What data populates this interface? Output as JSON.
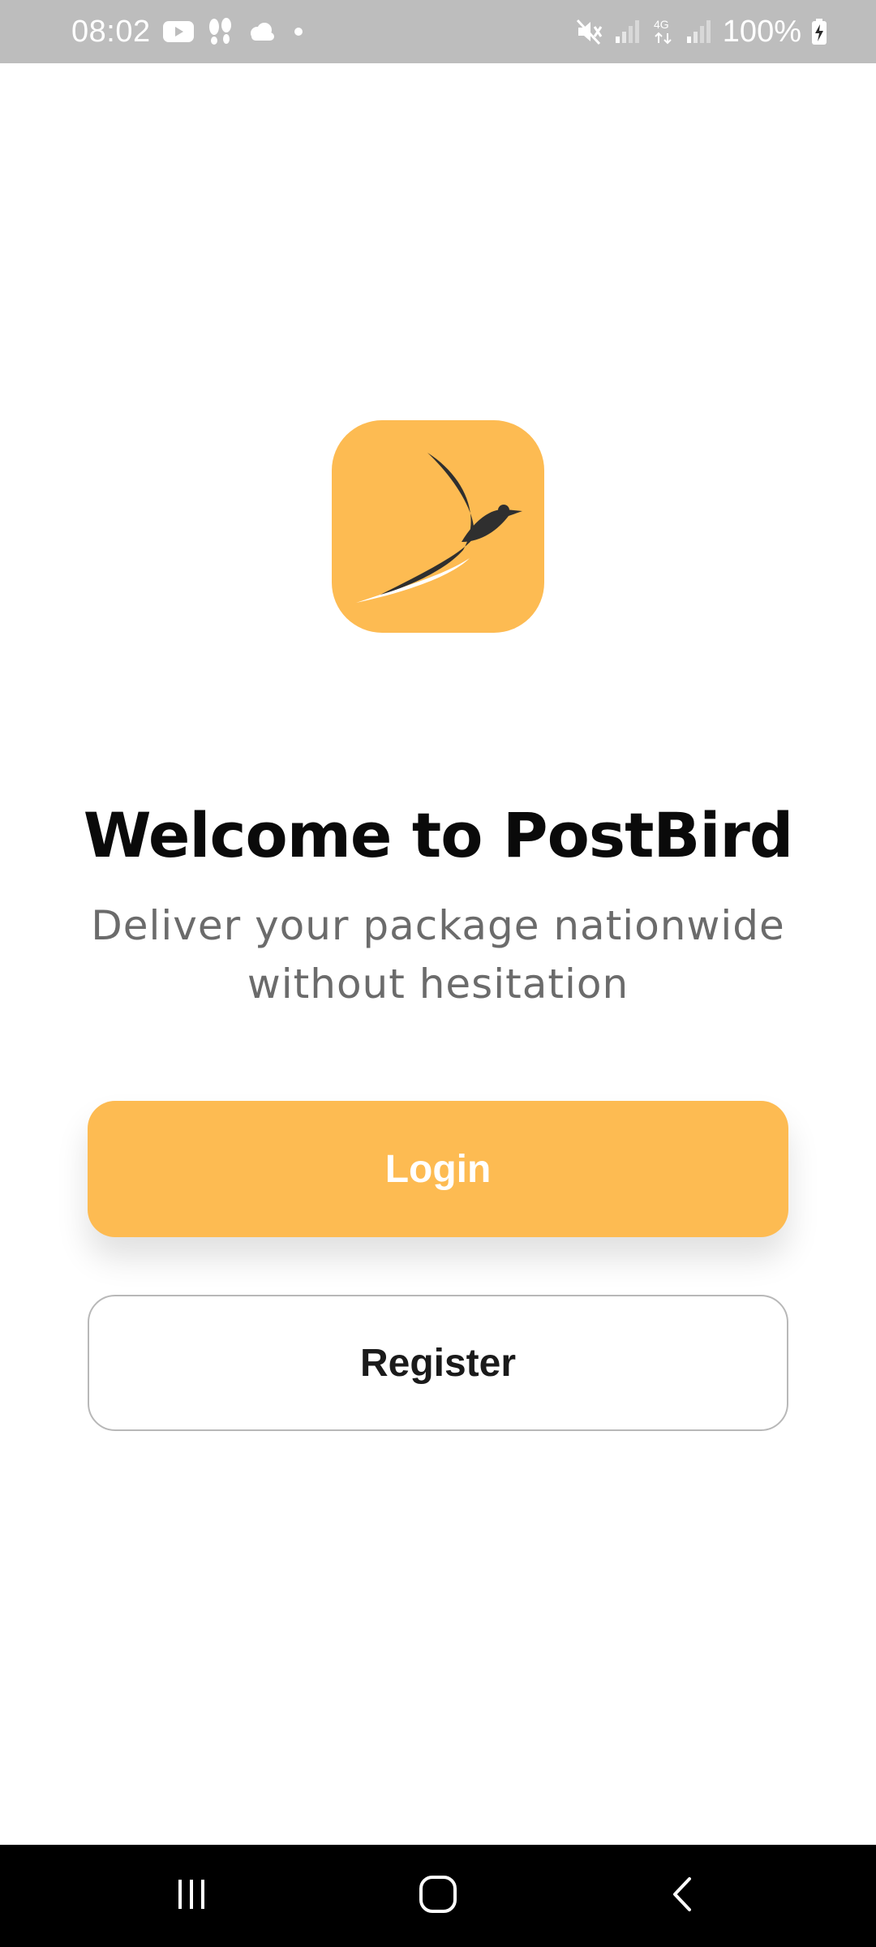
{
  "status_bar": {
    "time": "08:02",
    "battery": "100%",
    "network": "4G",
    "icons_left": [
      "youtube-icon",
      "footprints-icon",
      "cloud-icon",
      "dot-icon"
    ],
    "icons_right": [
      "mute-icon",
      "signal-icon",
      "4g-data-icon",
      "signal-icon",
      "battery-charging-icon"
    ]
  },
  "logo": {
    "icon": "postbird-logo",
    "background_color": "#fdbb52"
  },
  "welcome": {
    "title": "Welcome to PostBird",
    "subtitle_line1": "Deliver your package nationwide",
    "subtitle_line2": "without hesitation"
  },
  "buttons": {
    "login_label": "Login",
    "register_label": "Register",
    "login_color": "#fdbb52"
  },
  "nav_bar": {
    "icons": [
      "recent-apps-icon",
      "home-icon",
      "back-icon"
    ]
  }
}
